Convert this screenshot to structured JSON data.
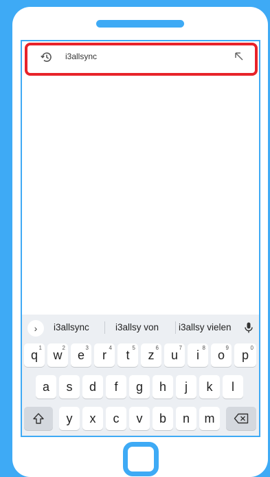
{
  "suggestion": {
    "text": "i3allsync"
  },
  "predictions": [
    "i3allsync",
    "i3allsy von",
    "i3allsy vielen"
  ],
  "keyboard": {
    "row1": [
      {
        "letter": "q",
        "digit": "1"
      },
      {
        "letter": "w",
        "digit": "2"
      },
      {
        "letter": "e",
        "digit": "3"
      },
      {
        "letter": "r",
        "digit": "4"
      },
      {
        "letter": "t",
        "digit": "5"
      },
      {
        "letter": "z",
        "digit": "6"
      },
      {
        "letter": "u",
        "digit": "7"
      },
      {
        "letter": "i",
        "digit": "8"
      },
      {
        "letter": "o",
        "digit": "9"
      },
      {
        "letter": "p",
        "digit": "0"
      }
    ],
    "row2": [
      "a",
      "s",
      "d",
      "f",
      "g",
      "h",
      "j",
      "k",
      "l"
    ],
    "row3": [
      "y",
      "x",
      "c",
      "v",
      "b",
      "n",
      "m"
    ]
  },
  "colors": {
    "frame": "#3eaaf5",
    "highlight": "#e8232a",
    "keyboard_bg": "#eceff3"
  }
}
